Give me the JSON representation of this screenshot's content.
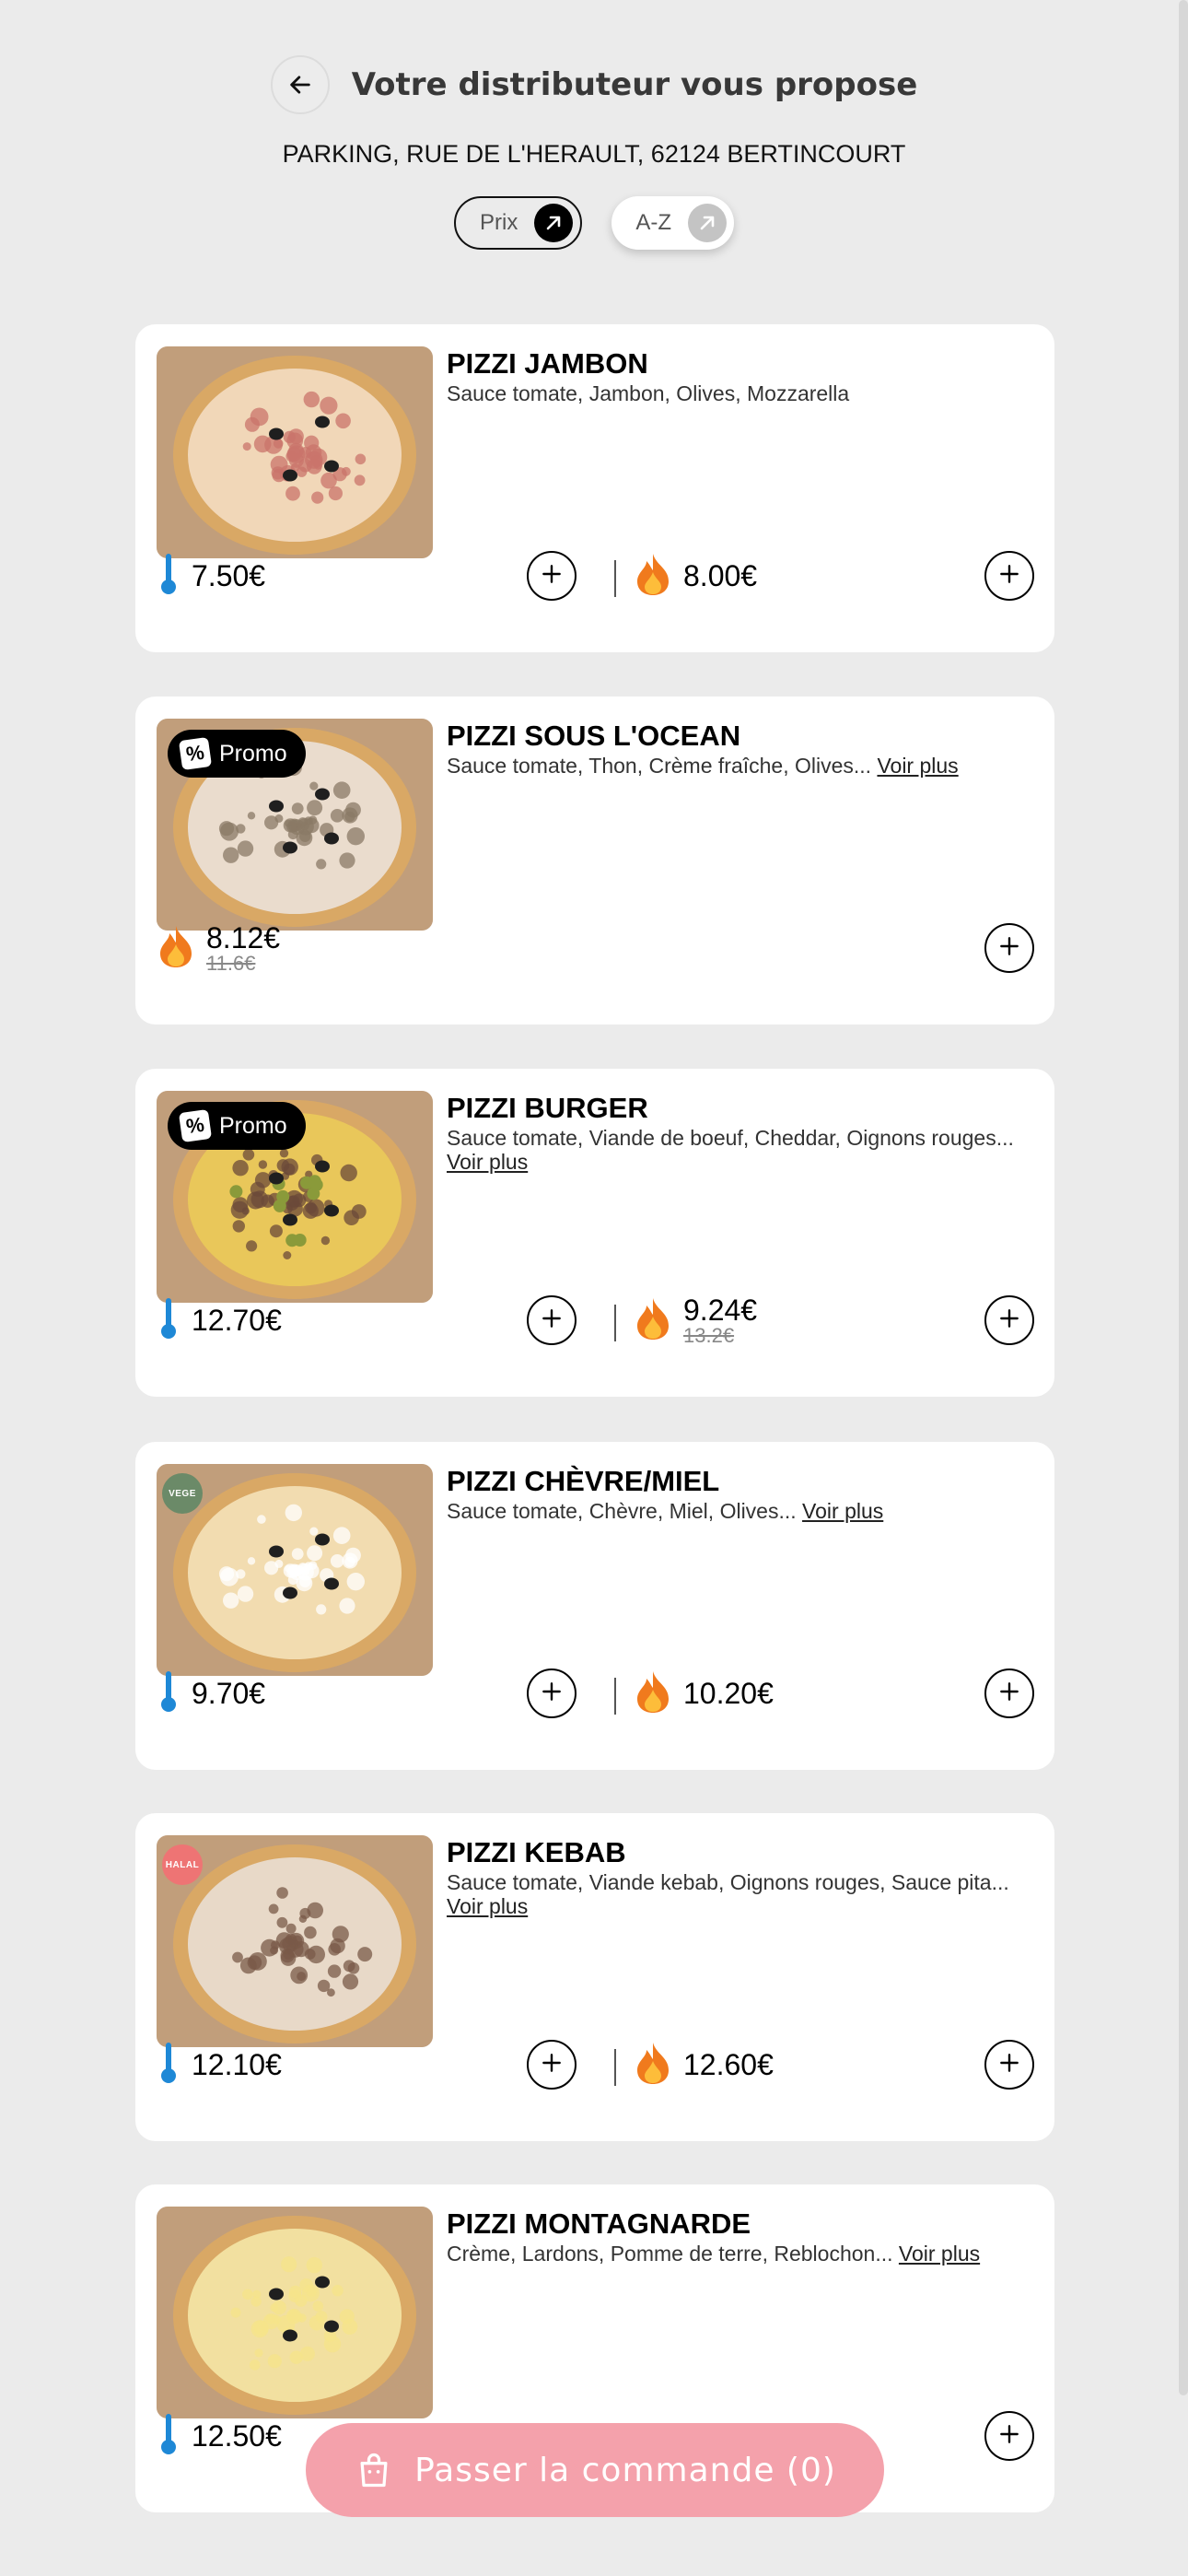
{
  "header": {
    "title": "Votre distributeur vous propose",
    "address": "PARKING, RUE DE L'HERAULT, 62124 BERTINCOURT"
  },
  "sort": {
    "price_label": "Prix",
    "az_label": "A-Z"
  },
  "products": [
    {
      "name": "PIZZI JAMBON",
      "desc": "Sauce tomate, Jambon, Olives, Mozzarella",
      "more": "",
      "badge": "",
      "cold_price": "7.50€",
      "hot_price": "8.00€",
      "hot_old_price": "",
      "topping": "ham"
    },
    {
      "name": "PIZZI SOUS L'OCEAN",
      "desc": "Sauce tomate, Thon, Crème fraîche, Olives...",
      "more": "Voir plus",
      "badge": "Promo",
      "cold_price": "",
      "hot_price": "8.12€",
      "hot_old_price": "11.6€",
      "topping": "tuna"
    },
    {
      "name": "PIZZI BURGER",
      "desc": "Sauce tomate, Viande de boeuf, Cheddar, Oignons rouges...",
      "more": "Voir plus",
      "badge": "Promo",
      "cold_price": "12.70€",
      "hot_price": "9.24€",
      "hot_old_price": "13.2€",
      "topping": "burger"
    },
    {
      "name": "PIZZI CHÈVRE/MIEL",
      "desc": "Sauce tomate, Chèvre, Miel, Olives...",
      "more": "Voir plus",
      "badge": "VEGE",
      "cold_price": "9.70€",
      "hot_price": "10.20€",
      "hot_old_price": "",
      "topping": "goat"
    },
    {
      "name": "PIZZI KEBAB",
      "desc": "Sauce tomate, Viande kebab, Oignons rouges, Sauce pita...",
      "more": "Voir plus",
      "badge": "HALAL",
      "cold_price": "12.10€",
      "hot_price": "12.60€",
      "hot_old_price": "",
      "topping": "kebab"
    },
    {
      "name": "PIZZI MONTAGNARDE",
      "desc": "Crème, Lardons, Pomme de terre, Reblochon...",
      "more": "Voir plus",
      "badge": "",
      "cold_price": "12.50€",
      "hot_price": "",
      "hot_old_price": "",
      "topping": "mountain"
    }
  ],
  "checkout": {
    "label": "Passer la commande (0)"
  },
  "colors": {
    "background": "#ebebeb",
    "checkout": "#f4a1ab",
    "vege_badge": "#6b8a68",
    "halal_badge": "#ee7474",
    "thermometer": "#1e88d6"
  },
  "icons": {
    "back": "arrow-left-icon",
    "sort": "arrow-up-right-icon",
    "cold": "thermometer-icon",
    "hot": "flame-icon",
    "add": "plus-icon",
    "cart": "bag-icon",
    "promo": "percent-tag-icon"
  }
}
